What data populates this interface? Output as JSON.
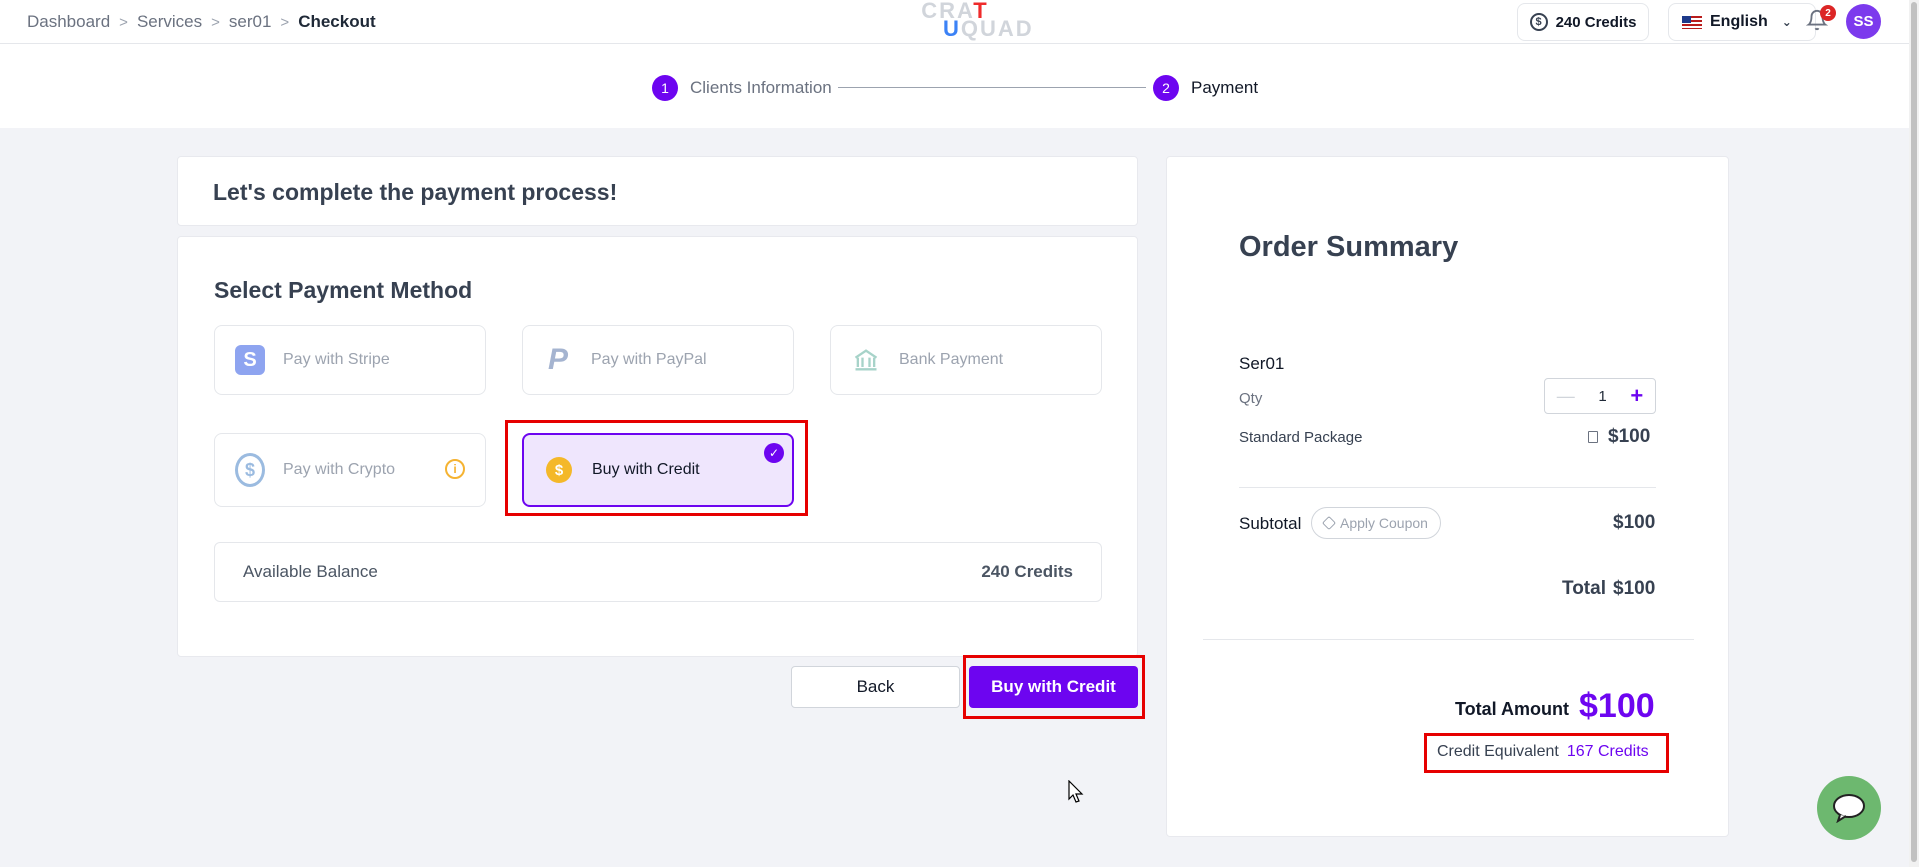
{
  "breadcrumb": {
    "items": [
      "Dashboard",
      "Services",
      "ser01"
    ],
    "current": "Checkout"
  },
  "logo": {
    "line1": "CRA",
    "t": "T",
    "line2": "QUAD",
    "u": "U"
  },
  "header": {
    "credits": "240 Credits",
    "language": "English",
    "notifications": "2",
    "avatar": "SS"
  },
  "stepper": {
    "step1": {
      "num": "1",
      "label": "Clients Information"
    },
    "step2": {
      "num": "2",
      "label": "Payment"
    }
  },
  "intro": {
    "title": "Let's complete the payment process!"
  },
  "methods": {
    "title": "Select Payment Method",
    "stripe": "Pay with Stripe",
    "paypal": "Pay with PayPal",
    "bank": "Bank Payment",
    "crypto": "Pay with Crypto",
    "credit": "Buy with Credit",
    "selected": "credit"
  },
  "balance": {
    "label": "Available Balance",
    "value": "240 Credits"
  },
  "actions": {
    "back": "Back",
    "buy": "Buy with Credit"
  },
  "summary": {
    "title": "Order Summary",
    "item": "Ser01",
    "qty_label": "Qty",
    "qty": "1",
    "package": "Standard Package",
    "package_price": "$100",
    "subtotal_label": "Subtotal",
    "coupon": "Apply Coupon",
    "subtotal": "$100",
    "total_label": "Total",
    "total": "$100",
    "amount_label": "Total Amount",
    "amount": "$100",
    "equivalent_label": "Credit Equivalent",
    "equivalent": "167 Credits"
  },
  "colors": {
    "accent": "#6d05f0",
    "highlight": "#e60000",
    "chat": "#6db86f"
  }
}
